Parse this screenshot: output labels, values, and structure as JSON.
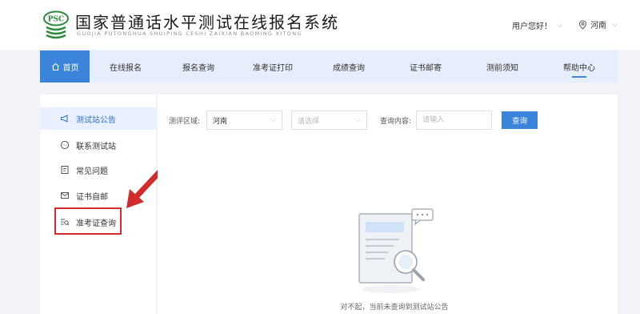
{
  "header": {
    "logo_text": "PSC",
    "title": "国家普通话水平测试在线报名系统",
    "subtitle": "GUOJIA PUTONGHUA SHUIPING CESHI ZAIXIAN BAOMING XITONG",
    "greeting": "用户您好！",
    "region": "河南"
  },
  "nav": {
    "items": [
      {
        "label": "首页",
        "icon": "home-icon",
        "active": true
      },
      {
        "label": "在线报名"
      },
      {
        "label": "报名查询"
      },
      {
        "label": "准考证打印"
      },
      {
        "label": "成绩查询"
      },
      {
        "label": "证书邮寄"
      },
      {
        "label": "测前须知"
      },
      {
        "label": "帮助中心",
        "underlined": true
      }
    ]
  },
  "sidebar": {
    "items": [
      {
        "label": "测试站公告",
        "icon": "megaphone-icon",
        "active": true
      },
      {
        "label": "联系测试站",
        "icon": "chat-icon"
      },
      {
        "label": "常见问题",
        "icon": "document-icon"
      },
      {
        "label": "证书自邮",
        "icon": "mail-icon"
      },
      {
        "label": "准考证查询",
        "icon": "search-list-icon",
        "highlighted": true
      }
    ]
  },
  "filters": {
    "area_label": "测评区域:",
    "area_value": "河南",
    "site_placeholder": "请选择",
    "query_label": "查询内容:",
    "query_placeholder": "请输入",
    "search_button": "查询"
  },
  "empty_state": {
    "message": "对不起，当前未查询到测试站公告"
  },
  "colors": {
    "primary": "#3a84dc",
    "nav_bg": "#e5eefa",
    "annotation_red": "#d12b2b",
    "logo_green": "#2e8b3e"
  }
}
